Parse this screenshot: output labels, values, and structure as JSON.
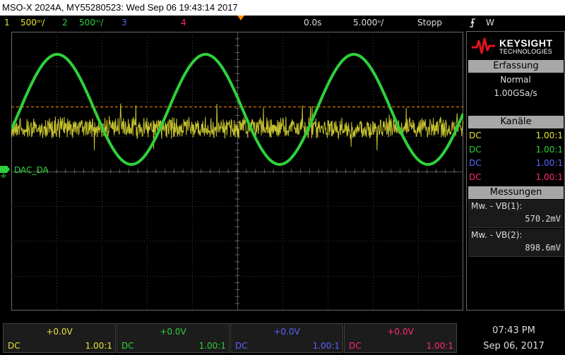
{
  "title": "MSO-X 2024A, MY55280523: Wed Sep 06 19:43:14 2017",
  "colors": {
    "ch1": "#e8e337",
    "ch2": "#2ed13a",
    "ch3": "#5a63ff",
    "ch4": "#ff2a74",
    "trigger": "#ff8a00"
  },
  "status": {
    "ch1_num": "1",
    "ch1_scale": "500ᵐ/",
    "ch2_num": "2",
    "ch2_scale": "500ᵐ/",
    "ch3_num": "3",
    "ch4_num": "4",
    "delay": "0.0s",
    "timebase": "5.000ᵘ/",
    "run_state": "Stopp",
    "trigger_icon": "trigger-edge-icon",
    "trigger_source": "W"
  },
  "screen": {
    "channel_label": "DAC_DA",
    "ground_marker": "ground-icon"
  },
  "side_panel": {
    "brand": "KEYSIGHT",
    "brand_sub": "TECHNOLOGIES",
    "acquisition": {
      "header": "Erfassung",
      "mode": "Normal",
      "rate": "1.00GSa/s"
    },
    "channels": {
      "header": "Kanäle",
      "rows": [
        {
          "coupling": "DC",
          "ratio": "1.00:1"
        },
        {
          "coupling": "DC",
          "ratio": "1.00:1"
        },
        {
          "coupling": "DC",
          "ratio": "1.00:1"
        },
        {
          "coupling": "DC",
          "ratio": "1.00:1"
        }
      ]
    },
    "measurements": {
      "header": "Messungen",
      "items": [
        {
          "label": "Mw. - VB(1):",
          "value": "570.2mV"
        },
        {
          "label": "Mw. - VB(2):",
          "value": "898.6mV"
        }
      ]
    }
  },
  "bottom": {
    "channels": [
      {
        "offset": "+0.0V",
        "coupling": "DC",
        "ratio": "1.00:1"
      },
      {
        "offset": "+0.0V",
        "coupling": "DC",
        "ratio": "1.00:1"
      },
      {
        "offset": "+0.0V",
        "coupling": "DC",
        "ratio": "1.00:1"
      },
      {
        "offset": "+0.0V",
        "coupling": "DC",
        "ratio": "1.00:1"
      }
    ],
    "time": "07:43 PM",
    "date": "Sep 06, 2017"
  }
}
